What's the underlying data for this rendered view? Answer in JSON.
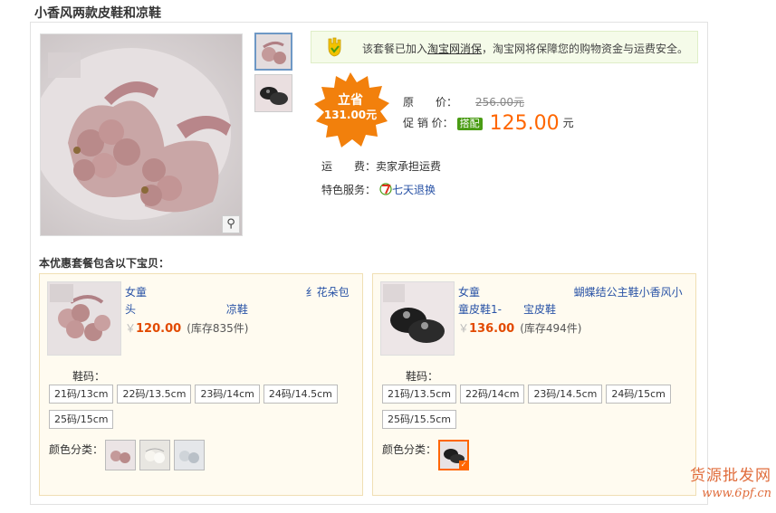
{
  "page": {
    "title": "小香风两款皮鞋和凉鞋"
  },
  "notice": {
    "prefix": "该套餐已加入",
    "link": "淘宝网消保",
    "suffix": "，淘宝网将保障您的购物资金与运费安全。"
  },
  "savings": {
    "label": "立省",
    "amount": "131.00元"
  },
  "price": {
    "original_label": "原　　价：",
    "original_value": "256.00元",
    "promo_label": "促 销 价：",
    "promo_tag": "搭配",
    "promo_value": "125.00",
    "promo_unit": "元"
  },
  "shipping": {
    "label": "运　　费：",
    "value": "卖家承担运费"
  },
  "service": {
    "label": "特色服务：",
    "value": "七天退换"
  },
  "section_title": "本优惠套餐包含以下宝贝：",
  "products": [
    {
      "name": "女童 　　　　　　　　　　　　　　 纟花朵包头 　　　　　　　　凉鞋",
      "currency": "￥",
      "price": "120.00",
      "stock": "(库存835件)",
      "size_label": "鞋码：",
      "sizes": [
        "21码/13cm",
        "22码/13.5cm",
        "23码/14cm",
        "24码/14.5cm",
        "25码/15cm"
      ],
      "color_label": "颜色分类："
    },
    {
      "name": "女童 　　　　　　　　 蝴蝶结公主鞋小香风小童皮鞋1-　　宝皮鞋",
      "currency": "￥",
      "price": "136.00",
      "stock": "(库存494件)",
      "size_label": "鞋码：",
      "sizes": [
        "21码/13.5cm",
        "22码/14cm",
        "23码/14.5cm",
        "24码/15cm",
        "25码/15.5cm"
      ],
      "color_label": "颜色分类："
    }
  ],
  "watermark": {
    "line1": "货源批发网",
    "line2": "www.6pf.cn"
  },
  "colors": {
    "accent": "#ff6600",
    "link": "#2953a6",
    "savings": "#f07f0a"
  }
}
